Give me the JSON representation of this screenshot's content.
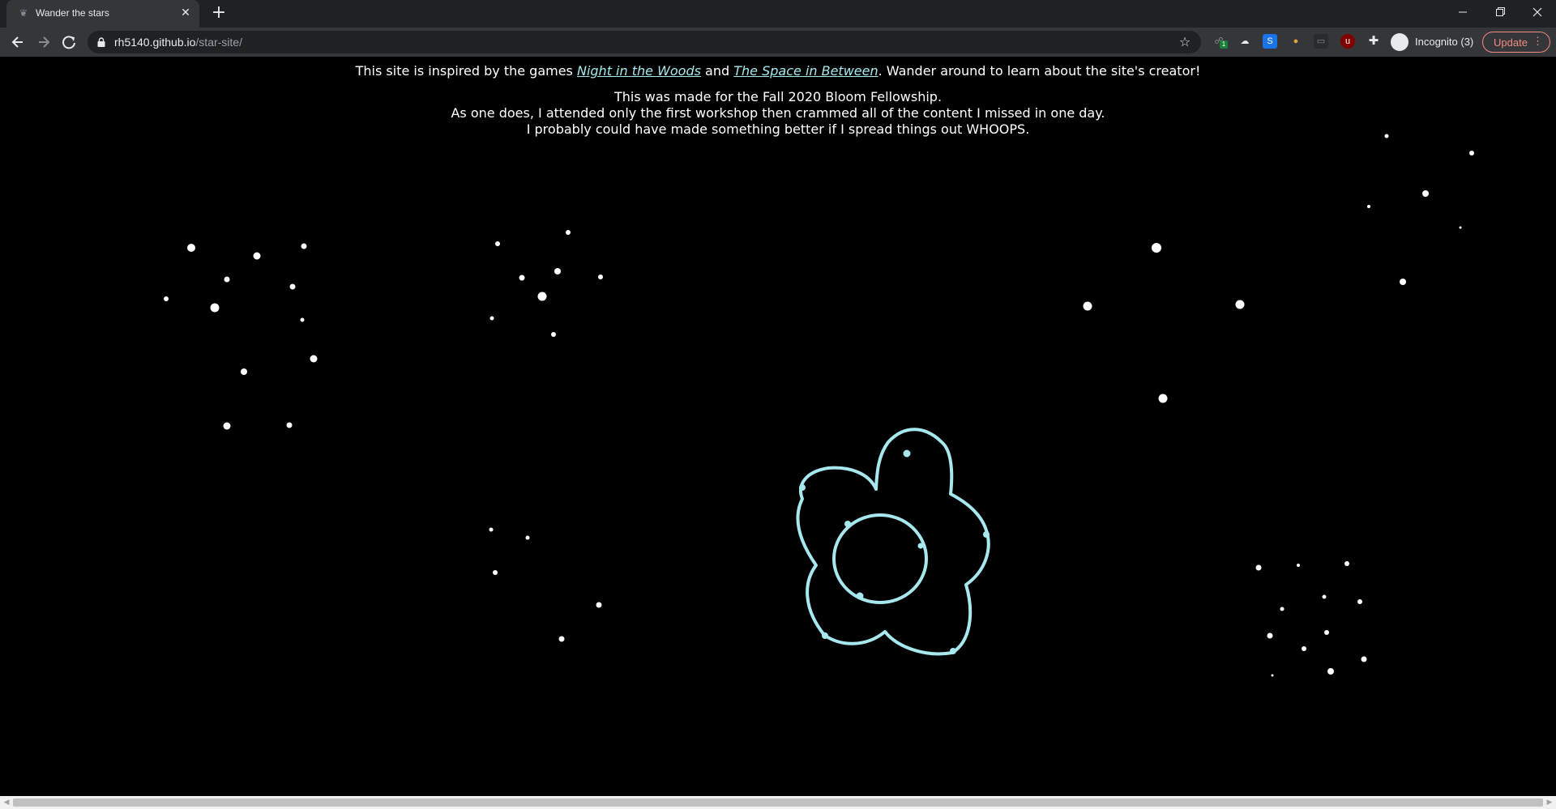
{
  "browser": {
    "tab_title": "Wander the stars",
    "url_host": "rh5140.github.io",
    "url_path": "/star-site/",
    "profile_label": "Incognito (3)",
    "update_label": "Update",
    "extension_badge": "1",
    "accent_color": "#f28b82"
  },
  "page": {
    "intro_before": "This site is inspired by the games ",
    "link1": "Night in the Woods",
    "intro_middle": " and ",
    "link2": "The Space in Between",
    "intro_after": ". Wander around to learn about the site's creator!",
    "note_lines": [
      "This was made for the Fall 2020 Bloom Fellowship.",
      "As one does, I attended only the first workshop then crammed all of the content I missed in one day.",
      "I probably could have made something better if I spread things out WHOOPS."
    ],
    "highlight_color": "#a6e8ee",
    "background_color": "#000000"
  }
}
